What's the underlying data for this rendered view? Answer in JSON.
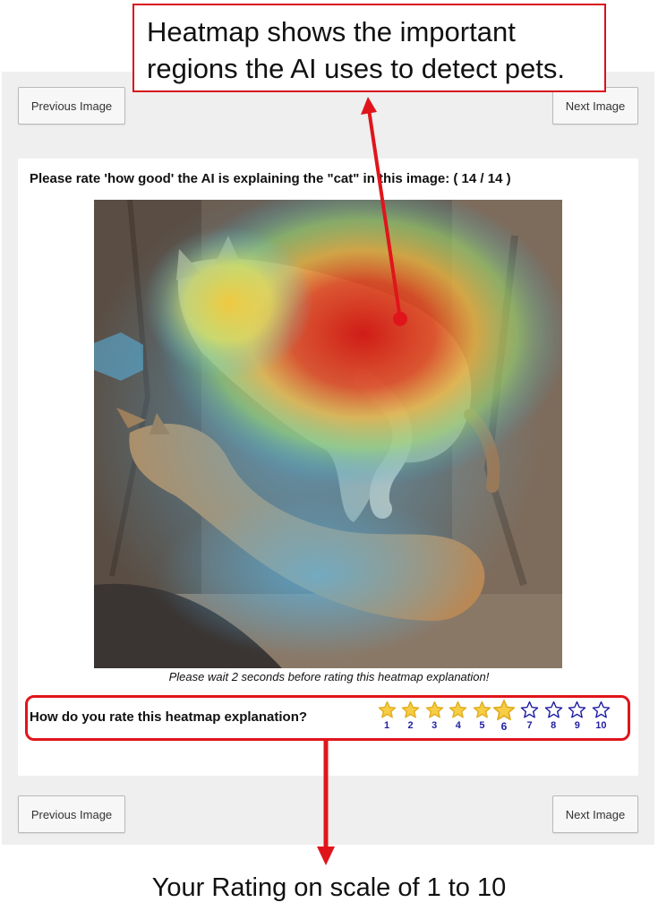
{
  "nav": {
    "previous_label": "Previous Image",
    "next_label": "Next Image"
  },
  "question": {
    "text": "Please rate 'how good' the AI is explaining the \"cat\" in this image: ( 14 / 14 )"
  },
  "wait_note": "Please wait 2 seconds before rating this heatmap explanation!",
  "rating": {
    "question": "How do you rate this heatmap explanation?",
    "selected": 6,
    "max": 10,
    "stars": [
      "1",
      "2",
      "3",
      "4",
      "5",
      "6",
      "7",
      "8",
      "9",
      "10"
    ],
    "filled_color": "#f6cd45",
    "empty_color": "#1f1fa3"
  },
  "annotations": {
    "callout_line1": "Heatmap shows the important",
    "callout_line2": "regions the AI uses to detect pets.",
    "caption": "Your Rating on scale of 1 to 10",
    "arrow_color": "#e0151b"
  }
}
